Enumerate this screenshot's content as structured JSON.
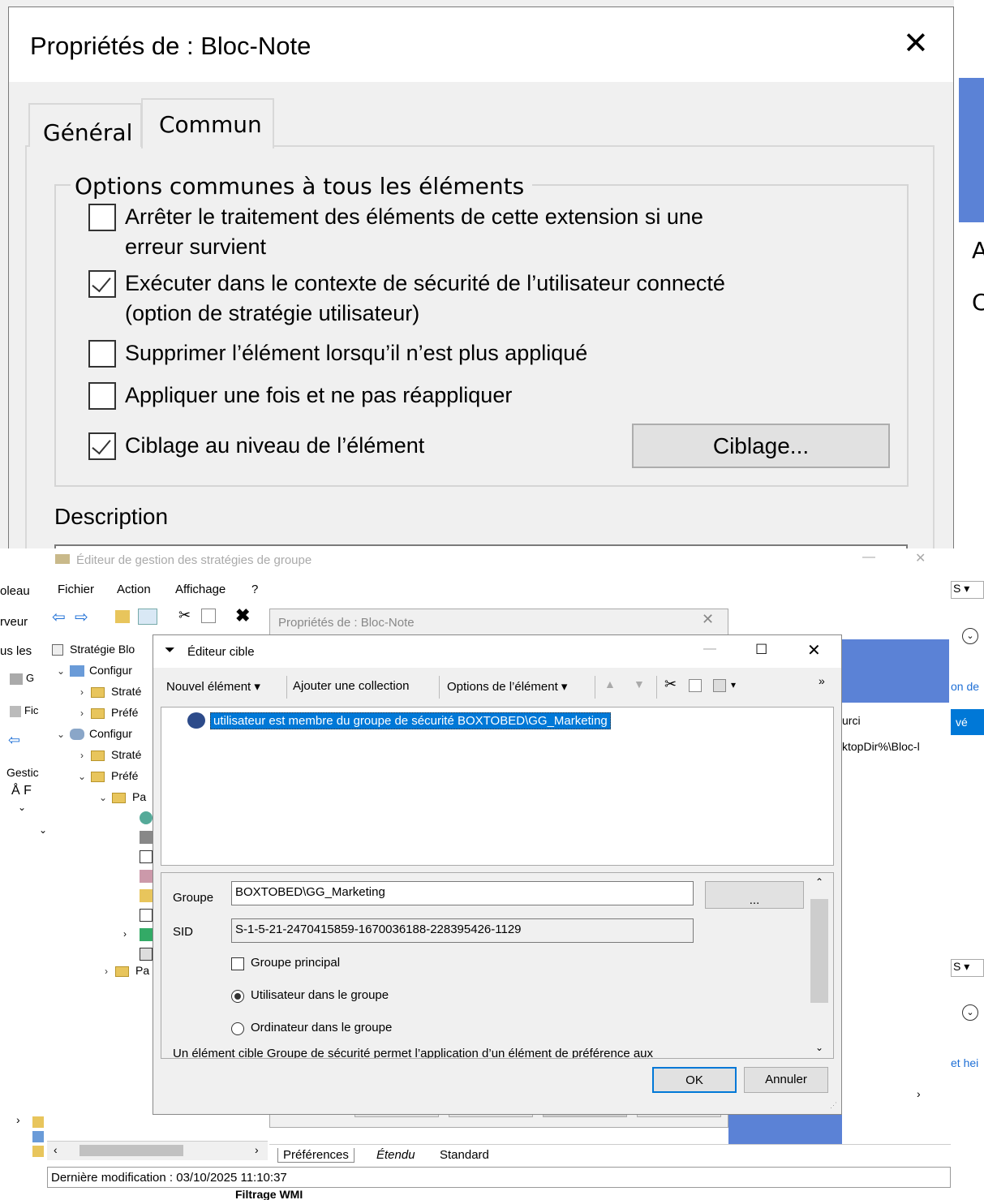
{
  "top": {
    "title": "Propriétés de : Bloc-Note",
    "tabs": [
      "Général",
      "Commun"
    ],
    "group_legend": "Options communes à tous les éléments",
    "options": [
      {
        "line1": "Arrêter le traitement des éléments de cette extension si une",
        "line2": "erreur survient",
        "checked": false
      },
      {
        "line1": "Exécuter dans le contexte de sécurité de l’utilisateur connecté",
        "line2": "(option de stratégie utilisateur)",
        "checked": true
      },
      {
        "line1": "Supprimer l’élément lorsqu’il n’est plus appliqué",
        "line2": "",
        "checked": false
      },
      {
        "line1": "Appliquer une fois et ne pas réappliquer",
        "line2": "",
        "checked": false
      },
      {
        "line1": "Ciblage au niveau de l’élément",
        "line2": "",
        "checked": true
      }
    ],
    "ciblage_button": "Ciblage...",
    "description_label": "Description",
    "right_letters": [
      "A",
      "C"
    ]
  },
  "gpme": {
    "title": "Éditeur de gestion des stratégies de groupe",
    "menu": [
      "Fichier",
      "Action",
      "Affichage",
      "?"
    ],
    "left_cut": [
      "oleau",
      "rveur",
      "us les",
      "Gestic"
    ],
    "left_cut_items": [
      "G",
      "Fic"
    ],
    "tree": [
      "Stratégie Blo",
      "Configur",
      "Straté",
      "Préfé",
      "Configur",
      "Straté",
      "Préfé",
      "Pa",
      "Pa"
    ],
    "behind_dialog_title": "Propriétés de : Bloc-Note",
    "right_texts": [
      "urci",
      "ktopDir%\\Bloc-l"
    ],
    "far_right": [
      "S",
      "on de",
      "vé",
      "S",
      "et hei"
    ],
    "bottom_tabs": [
      "Préférences",
      "Étendu",
      "Standard"
    ],
    "status": "Dernière modification : 03/10/2025 11:10:37",
    "below_status": "Filtrage WMI"
  },
  "target_editor": {
    "title": "Éditeur cible",
    "toolbar": {
      "new_item": "Nouvel élément",
      "add_collection": "Ajouter une collection",
      "item_options": "Options de l’élément"
    },
    "list_item": "utilisateur est membre du groupe de sécurité BOXTOBED\\GG_Marketing",
    "group_label": "Groupe",
    "group_value": "BOXTOBED\\GG_Marketing",
    "browse_button": "...",
    "sid_label": "SID",
    "sid_value": "S-1-5-21-2470415859-1670036188-228395426-1129",
    "primary_group": "Groupe principal",
    "radio_user": "Utilisateur dans le groupe",
    "radio_computer": "Ordinateur dans le groupe",
    "description": "Un élément cible Groupe de sécurité permet l’application d’un élément de préférence aux",
    "ok": "OK",
    "cancel": "Annuler"
  }
}
